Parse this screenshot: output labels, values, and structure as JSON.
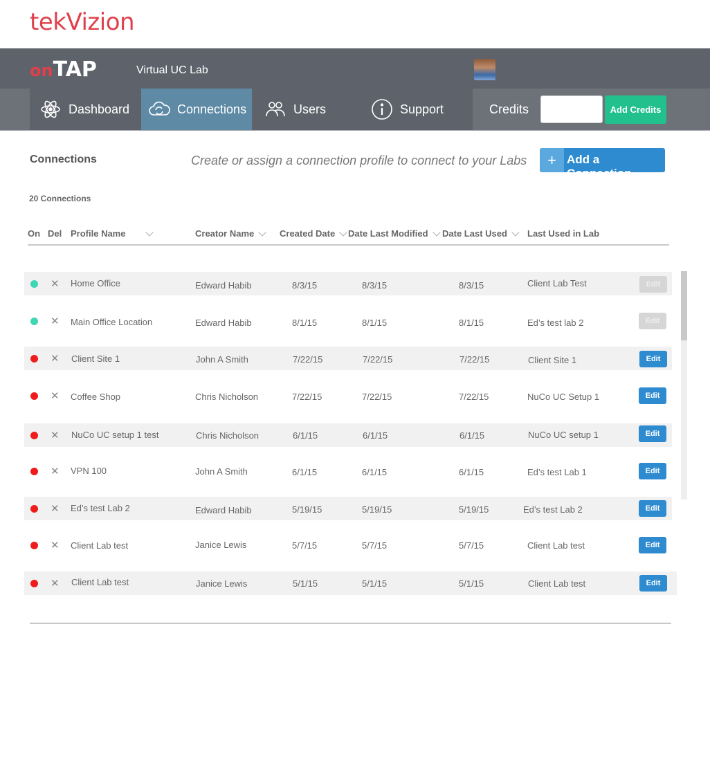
{
  "brand": {
    "logo_text": "tekVizion"
  },
  "header": {
    "app_logo_on": "on",
    "app_logo_tap": "TAP",
    "app_title": "Virtual UC Lab"
  },
  "nav": {
    "items": [
      {
        "label": "Dashboard",
        "icon": "atom-icon"
      },
      {
        "label": "Connections",
        "icon": "cloud-sync-icon",
        "active": true
      },
      {
        "label": "Users",
        "icon": "users-icon"
      },
      {
        "label": "Support",
        "icon": "info-icon"
      }
    ],
    "credits_label": "Credits",
    "credits_value": "",
    "add_credits_label": "Add Credits"
  },
  "page": {
    "title": "Connections",
    "subtitle": "Create or assign a connection profile to connect to your Labs",
    "add_button_label": "Add a Connection",
    "count_text": "20 Connections"
  },
  "colors": {
    "active_green": "#3ed6b4",
    "inactive_red": "#ee1c1c",
    "accent_blue": "#2e8bd0",
    "credits_green": "#21c08c",
    "brand_red": "#e0404b"
  },
  "table": {
    "headers": [
      "On",
      "Del",
      "Profile Name",
      "Creator Name",
      "Created Date",
      "Date Last Modified",
      "Date Last Used",
      "Last Used in Lab"
    ],
    "edit_label": "Edit",
    "rows": [
      {
        "on": true,
        "profile": "Home Office",
        "creator": "Edward Habib",
        "created": "8/3/15",
        "modified": "8/3/15",
        "used": "8/3/15",
        "lab": "Client Lab Test",
        "edit_enabled": false
      },
      {
        "on": true,
        "profile": "Main Office Location",
        "creator": "Edward Habib",
        "created": "8/1/15",
        "modified": "8/1/15",
        "used": "8/1/15",
        "lab": "Ed’s test lab 2",
        "edit_enabled": false
      },
      {
        "on": false,
        "profile": "Client Site 1",
        "creator": "John A Smith",
        "created": "7/22/15",
        "modified": "7/22/15",
        "used": "7/22/15",
        "lab": "Client Site 1",
        "edit_enabled": true
      },
      {
        "on": false,
        "profile": "Coffee Shop",
        "creator": "Chris Nicholson",
        "created": "7/22/15",
        "modified": "7/22/15",
        "used": "7/22/15",
        "lab": "NuCo UC Setup 1",
        "edit_enabled": true
      },
      {
        "on": false,
        "profile": "NuCo UC setup 1 test",
        "creator": "Chris Nicholson",
        "created": "6/1/15",
        "modified": "6/1/15",
        "used": "6/1/15",
        "lab": "NuCo UC setup 1",
        "edit_enabled": true
      },
      {
        "on": false,
        "profile": "VPN 100",
        "creator": "John A Smith",
        "created": "6/1/15",
        "modified": "6/1/15",
        "used": "6/1/15",
        "lab": "Ed’s test Lab 1",
        "edit_enabled": true
      },
      {
        "on": false,
        "profile": "Ed’s test Lab 2",
        "creator": "Edward Habib",
        "created": "5/19/15",
        "modified": "5/19/15",
        "used": "5/19/15",
        "lab": "Ed’s test Lab 2",
        "edit_enabled": true
      },
      {
        "on": false,
        "profile": "Client Lab test",
        "creator": "Janice Lewis",
        "created": "5/7/15",
        "modified": "5/7/15",
        "used": "5/7/15",
        "lab": "Client Lab test",
        "edit_enabled": true
      },
      {
        "on": false,
        "profile": "Client Lab test",
        "creator": "Janice Lewis",
        "created": "5/1/15",
        "modified": "5/1/15",
        "used": "5/1/15",
        "lab": "Client Lab test",
        "edit_enabled": true
      }
    ]
  }
}
